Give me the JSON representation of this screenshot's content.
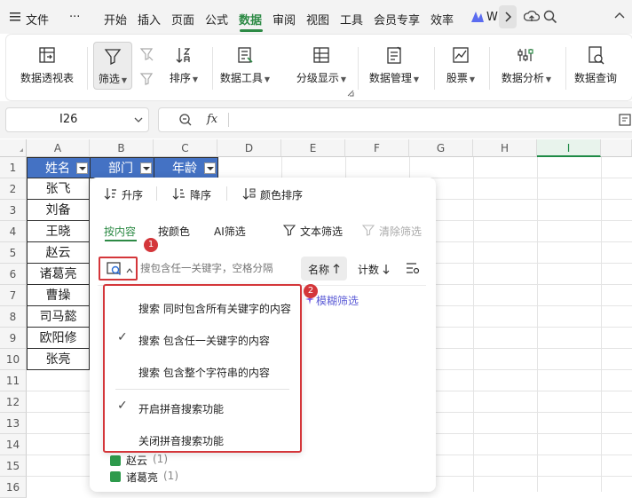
{
  "menubar": {
    "file": "文件",
    "more": "···",
    "tabs": [
      "开始",
      "插入",
      "页面",
      "公式",
      "数据",
      "审阅",
      "视图",
      "工具",
      "会员专享",
      "效率"
    ],
    "active_tab": "数据",
    "wps_ai": "W"
  },
  "ribbon": {
    "pivot": "数据透视表",
    "filter": "筛选",
    "sort": "排序",
    "data_tools": "数据工具",
    "outline": "分级显示",
    "data_mgmt": "数据管理",
    "stocks": "股票",
    "analysis": "数据分析",
    "query": "数据查询"
  },
  "formula_bar": {
    "cell_ref": "I26",
    "fx": "fx",
    "value": ""
  },
  "grid": {
    "columns": [
      "A",
      "B",
      "C",
      "D",
      "E",
      "F",
      "G",
      "H",
      "I"
    ],
    "rows": [
      "1",
      "2",
      "3",
      "4",
      "5",
      "6",
      "7",
      "8",
      "9",
      "10",
      "11",
      "12",
      "13",
      "14",
      "15",
      "16"
    ],
    "header_cells": [
      "姓名",
      "部门",
      "年龄"
    ],
    "names": [
      "张飞",
      "刘备",
      "王晓",
      "赵云",
      "诸葛亮",
      "曹操",
      "司马懿",
      "欧阳修",
      "张亮"
    ]
  },
  "filter_panel": {
    "sort_asc": "升序",
    "sort_desc": "降序",
    "color_sort": "颜色排序",
    "tabs": [
      "按内容",
      "按颜色",
      "AI筛选"
    ],
    "text_filter": "文本筛选",
    "clear_filter": "清除筛选",
    "search_placeholder": "搜包含任一关键字，空格分隔",
    "name_sort": "名称",
    "count_sort": "计数",
    "fuzzy": "模糊筛选",
    "list": [
      {
        "label": "赵云",
        "count": "(1)"
      },
      {
        "label": "诸葛亮",
        "count": "(1)"
      }
    ]
  },
  "dropdown": {
    "items": [
      {
        "label": "搜索 同时包含所有关键字的内容",
        "checked": false
      },
      {
        "label": "搜索 包含任一关键字的内容",
        "checked": true
      },
      {
        "label": "搜索 包含整个字符串的内容",
        "checked": false
      },
      {
        "label": "开启拼音搜索功能",
        "checked": true
      },
      {
        "label": "关闭拼音搜索功能",
        "checked": false
      }
    ]
  },
  "badges": [
    "1",
    "2"
  ],
  "colors": {
    "accent_green": "#2d8a45",
    "header_blue": "#4472c4",
    "highlight_red": "#d4363a",
    "selected_col": "#1e8a45"
  }
}
